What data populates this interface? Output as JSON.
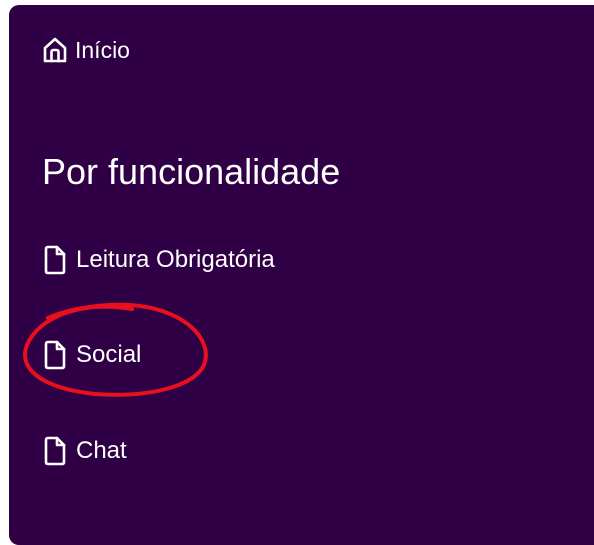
{
  "nav": {
    "home": {
      "label": "Início",
      "icon": "home-icon"
    },
    "section_title": "Por funcionalidade",
    "items": [
      {
        "label": "Leitura Obrigatória",
        "icon": "file-icon"
      },
      {
        "label": "Social",
        "icon": "file-icon"
      },
      {
        "label": "Chat",
        "icon": "file-icon"
      }
    ]
  },
  "colors": {
    "panel_background": "#2f0045",
    "text": "#ffffff",
    "annotation_circle": "#e8101e"
  }
}
